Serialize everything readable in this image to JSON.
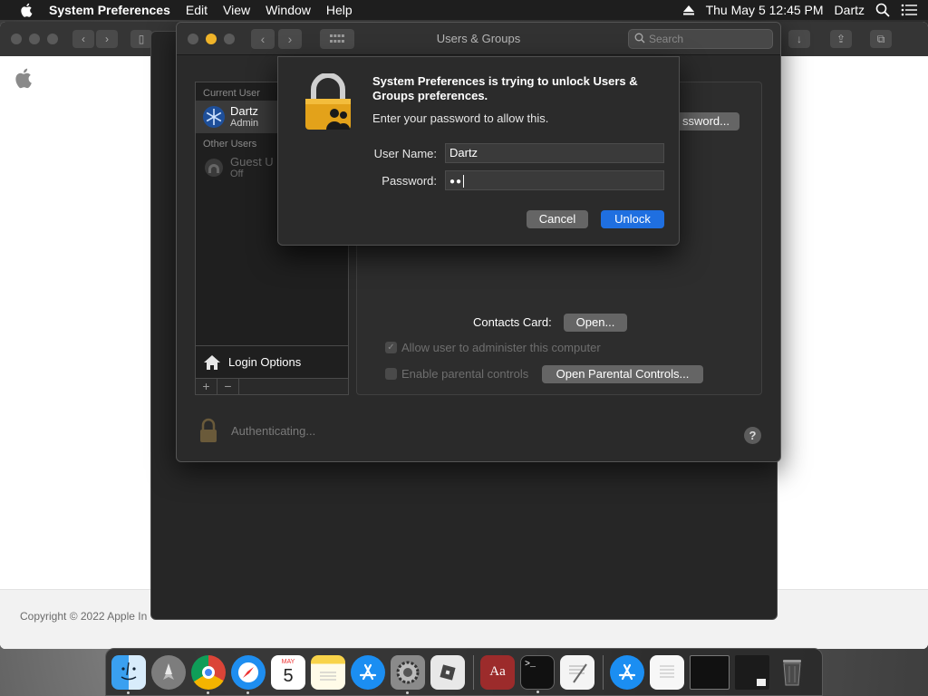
{
  "menubar": {
    "app_name": "System Preferences",
    "items": [
      "Edit",
      "View",
      "Window",
      "Help"
    ],
    "clock": "Thu May 5  12:45 PM",
    "user": "Dartz"
  },
  "browser": {
    "copyright": "Copyright © 2022 Apple In"
  },
  "window": {
    "title": "Users & Groups",
    "search_placeholder": "Search"
  },
  "userlist": {
    "current_header": "Current User",
    "current_user": {
      "name": "Dartz",
      "role": "Admin"
    },
    "other_header": "Other Users",
    "guest": {
      "name": "Guest U",
      "status": "Off"
    },
    "login_options": "Login Options"
  },
  "pane": {
    "password_button": "ssword...",
    "contacts_label": "Contacts Card:",
    "open_button": "Open...",
    "allow_admin": "Allow user to administer this computer",
    "parental": "Enable parental controls",
    "parental_button": "Open Parental Controls..."
  },
  "status": {
    "authenticating": "Authenticating..."
  },
  "dialog": {
    "heading": "System Preferences is trying to unlock Users & Groups preferences.",
    "instruction": "Enter your password to allow this.",
    "username_label": "User Name:",
    "username_value": "Dartz",
    "password_label": "Password:",
    "password_value": "●●",
    "cancel": "Cancel",
    "unlock": "Unlock"
  },
  "dock": {
    "calendar_month": "MAY",
    "calendar_day": "5"
  },
  "colors": {
    "accent": "#1f6fe0",
    "minimize": "#f0b429"
  }
}
